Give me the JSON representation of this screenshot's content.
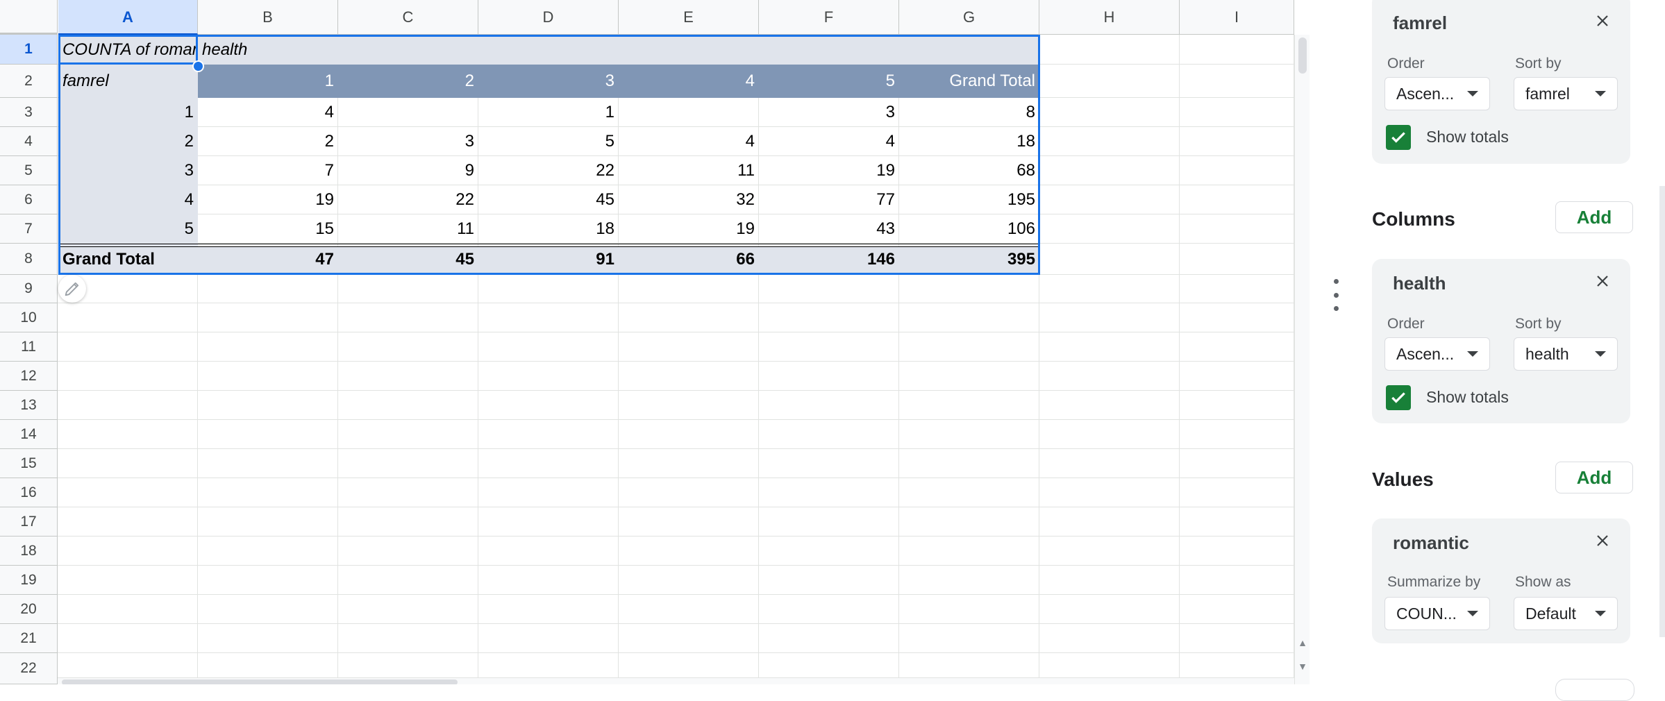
{
  "grid": {
    "columns": [
      "A",
      "B",
      "C",
      "D",
      "E",
      "F",
      "G",
      "H",
      "I"
    ],
    "rows": [
      "1",
      "2",
      "3",
      "4",
      "5",
      "6",
      "7",
      "8",
      "9",
      "10",
      "11",
      "12",
      "13",
      "14",
      "15",
      "16",
      "17",
      "18",
      "19",
      "20",
      "21",
      "22"
    ],
    "pivot": {
      "title": "COUNTA of romantic",
      "col_field": "health",
      "row_field": "famrel",
      "col_headers": [
        "1",
        "2",
        "3",
        "4",
        "5",
        "Grand Total"
      ],
      "body": [
        {
          "label": "1",
          "values": [
            "4",
            "",
            "1",
            "",
            "3",
            "8"
          ]
        },
        {
          "label": "2",
          "values": [
            "2",
            "3",
            "5",
            "4",
            "4",
            "18"
          ]
        },
        {
          "label": "3",
          "values": [
            "7",
            "9",
            "22",
            "11",
            "19",
            "68"
          ]
        },
        {
          "label": "4",
          "values": [
            "19",
            "22",
            "45",
            "32",
            "77",
            "195"
          ]
        },
        {
          "label": "5",
          "values": [
            "15",
            "11",
            "18",
            "19",
            "43",
            "106"
          ]
        }
      ],
      "total_label": "Grand Total",
      "totals": [
        "47",
        "45",
        "91",
        "66",
        "146",
        "395"
      ]
    },
    "colors": {
      "pivot_header": "#8096b5",
      "pivot_band": "#e0e4ec",
      "selection": "#1a73e8"
    }
  },
  "panel": {
    "rows_card": {
      "field": "famrel",
      "order_label": "Order",
      "order_value": "Ascen...",
      "sortby_label": "Sort by",
      "sortby_value": "famrel",
      "totals_label": "Show totals"
    },
    "columns_section": {
      "title": "Columns",
      "add_label": "Add"
    },
    "columns_card": {
      "field": "health",
      "order_label": "Order",
      "order_value": "Ascen...",
      "sortby_label": "Sort by",
      "sortby_value": "health",
      "totals_label": "Show totals"
    },
    "values_section": {
      "title": "Values",
      "add_label": "Add"
    },
    "values_card": {
      "field": "romantic",
      "summarize_label": "Summarize by",
      "summarize_value": "COUN...",
      "showas_label": "Show as",
      "showas_value": "Default"
    }
  }
}
